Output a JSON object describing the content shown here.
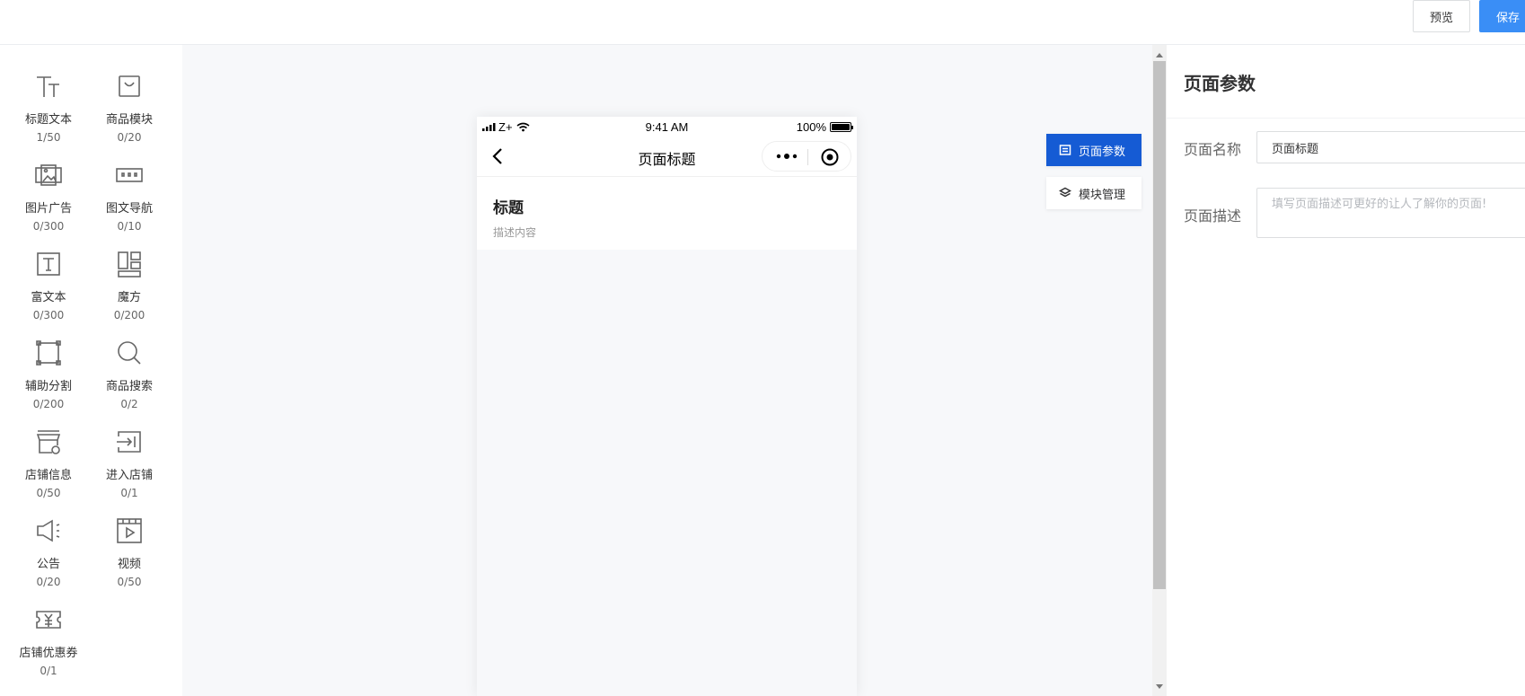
{
  "topbar": {
    "preview_label": "预览",
    "save_label": "保存"
  },
  "palette": {
    "items": [
      {
        "icon": "title-text-icon",
        "name": "标题文本",
        "count": "1/50"
      },
      {
        "icon": "goods-bag-icon",
        "name": "商品模块",
        "count": "0/20"
      },
      {
        "icon": "image-ad-icon",
        "name": "图片广告",
        "count": "0/300"
      },
      {
        "icon": "image-nav-icon",
        "name": "图文导航",
        "count": "0/10"
      },
      {
        "icon": "rich-text-icon",
        "name": "富文本",
        "count": "0/300"
      },
      {
        "icon": "cube-grid-icon",
        "name": "魔方",
        "count": "0/200"
      },
      {
        "icon": "divider-box-icon",
        "name": "辅助分割",
        "count": "0/200"
      },
      {
        "icon": "search-icon",
        "name": "商品搜索",
        "count": "0/2"
      },
      {
        "icon": "store-info-icon",
        "name": "店铺信息",
        "count": "0/50"
      },
      {
        "icon": "enter-store-icon",
        "name": "进入店铺",
        "count": "0/1"
      },
      {
        "icon": "megaphone-icon",
        "name": "公告",
        "count": "0/20"
      },
      {
        "icon": "video-icon",
        "name": "视频",
        "count": "0/50"
      },
      {
        "icon": "coupon-icon",
        "name": "店铺优惠券",
        "count": "0/1"
      }
    ]
  },
  "phone": {
    "status": {
      "carrier": "Z+",
      "time": "9:41 AM",
      "battery": "100%"
    },
    "nav_title": "页面标题",
    "header": {
      "title": "标题",
      "desc": "描述内容"
    }
  },
  "side_tabs": {
    "params_label": "页面参数",
    "modules_label": "模块管理"
  },
  "panel": {
    "title": "页面参数",
    "name_label": "页面名称",
    "name_value": "页面标题",
    "desc_label": "页面描述",
    "desc_placeholder": "填写页面描述可更好的让人了解你的页面!"
  },
  "colors": {
    "primary": "#155bd4",
    "save": "#3a8ef6",
    "canvas_bg": "#f7f8fa"
  }
}
